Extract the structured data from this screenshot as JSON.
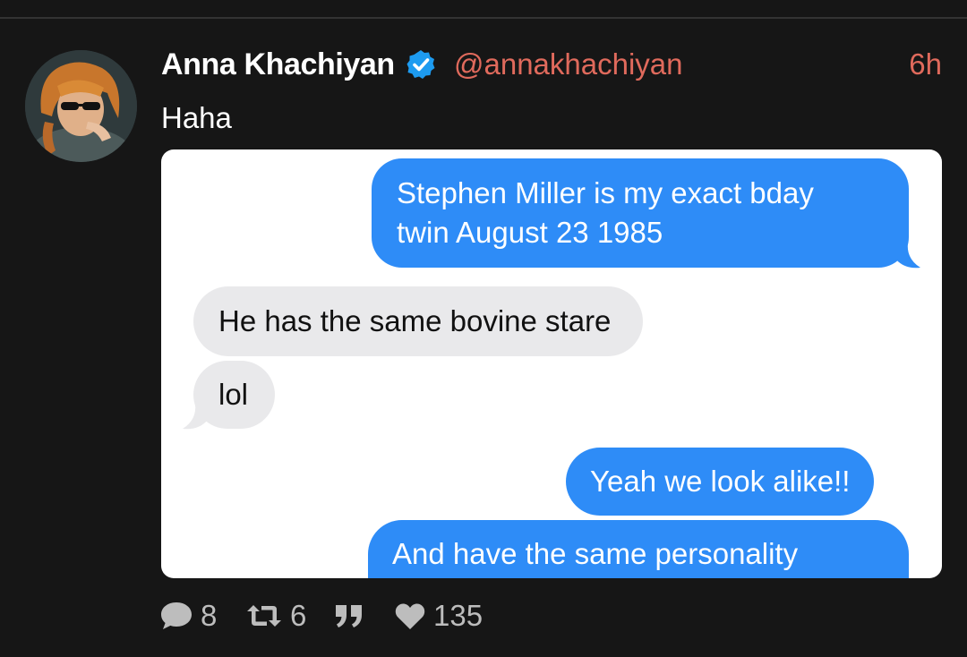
{
  "post": {
    "author": "Anna Khachiyan",
    "handle": "@annakhachiyan",
    "time": "6h",
    "text": "Haha"
  },
  "media": {
    "messages": [
      {
        "side": "outgoing",
        "line1": "Stephen Miller is my exact bday",
        "line2": "twin August 23 1985"
      },
      {
        "side": "incoming",
        "text": "He has the same bovine stare"
      },
      {
        "side": "incoming",
        "text": "lol"
      },
      {
        "side": "outgoing",
        "text": "Yeah we look alike!!"
      },
      {
        "side": "outgoing",
        "text": "And have the same personality"
      }
    ]
  },
  "actions": {
    "replies": "8",
    "boosts": "6",
    "likes": "135"
  },
  "icons": {
    "verified": "verified-badge-icon",
    "reply": "speech-bubble-icon",
    "boost": "retweet-icon",
    "quote": "quote-icon",
    "like": "heart-icon"
  },
  "colors": {
    "background": "#161616",
    "accent": "#e06a5c",
    "verified": "#1d9bf0",
    "imessage_blue": "#2e8cf7",
    "imessage_gray": "#e9e9eb",
    "action_gray": "#bdbdbd"
  }
}
